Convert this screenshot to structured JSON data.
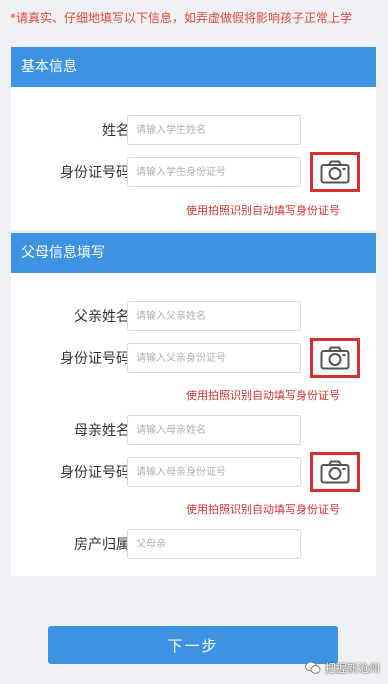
{
  "notice": "*请真实、仔细地填写以下信息，如弄虚做假将影响孩子正常上学",
  "basic": {
    "header": "基本信息",
    "name_label": "姓名",
    "name_placeholder": "请输入学生姓名",
    "id_label": "身份证号码",
    "id_placeholder": "请输入学生身份证号",
    "hint": "使用拍照识别自动填写身份证号"
  },
  "parents": {
    "header": "父母信息填写",
    "father_name_label": "父亲姓名",
    "father_name_placeholder": "请输入父亲姓名",
    "father_id_label": "身份证号码",
    "father_id_placeholder": "请输入父亲身份证号",
    "father_hint": "使用拍照识别自动填写身份证号",
    "mother_name_label": "母亲姓名",
    "mother_name_placeholder": "请输入母亲姓名",
    "mother_id_label": "身份证号码",
    "mother_id_placeholder": "请输入母亲身份证号",
    "mother_hint": "使用拍照识别自动填写身份证号",
    "property_label": "房产归属",
    "property_placeholder": "父母亲"
  },
  "next_button": "下一步",
  "watermark": "把握新沧州",
  "colors": {
    "accent": "#3d93e2",
    "warning": "#d63030",
    "background": "#eef0f3"
  },
  "icons": {
    "camera": "camera-icon",
    "wechat": "wechat-icon"
  }
}
